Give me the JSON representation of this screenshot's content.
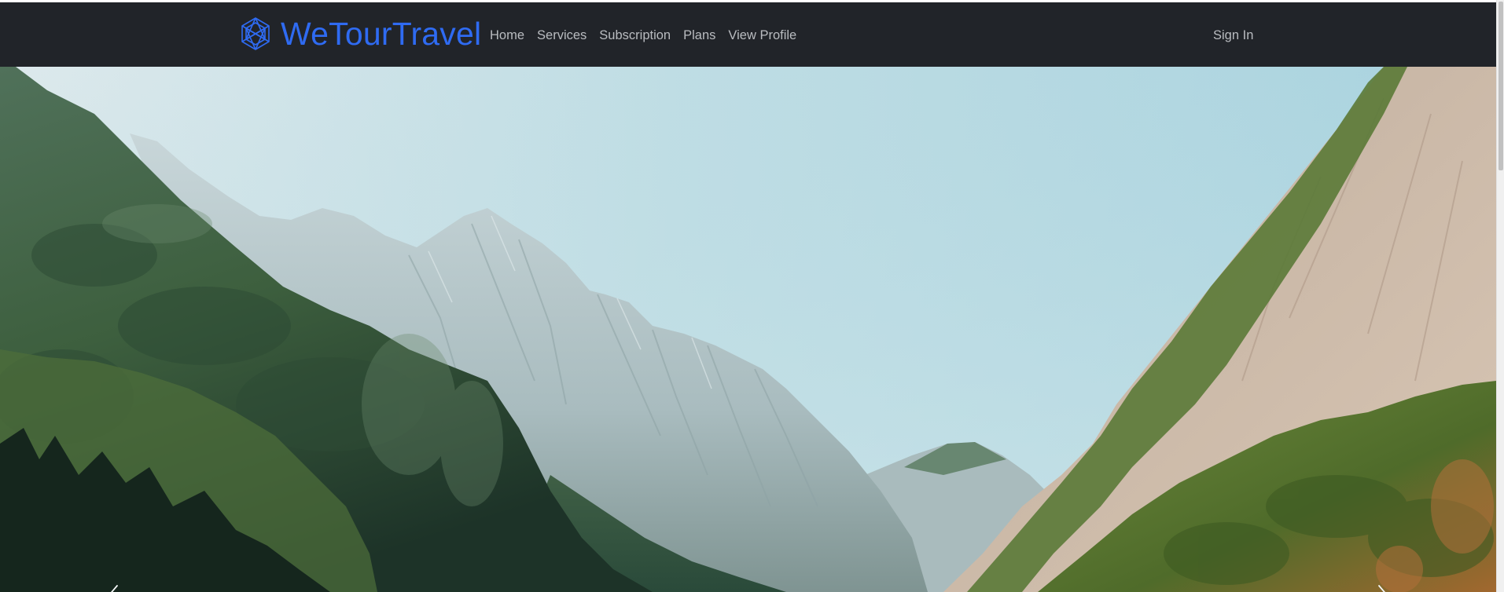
{
  "brand": {
    "name": "WeTourTravel",
    "icon": "globe-wireframe-icon",
    "color": "#2f6bf2"
  },
  "nav": {
    "items": [
      {
        "label": "Home"
      },
      {
        "label": "Services"
      },
      {
        "label": "Subscription"
      },
      {
        "label": "Plans"
      },
      {
        "label": "View Profile"
      }
    ],
    "sign_in": "Sign In"
  },
  "hero": {
    "image": "mountain-valley-photo",
    "prev_icon": "chevron-left-icon",
    "next_icon": "chevron-right-icon"
  },
  "colors": {
    "navbar_bg": "#212429",
    "nav_text": "#b9bcc0"
  }
}
